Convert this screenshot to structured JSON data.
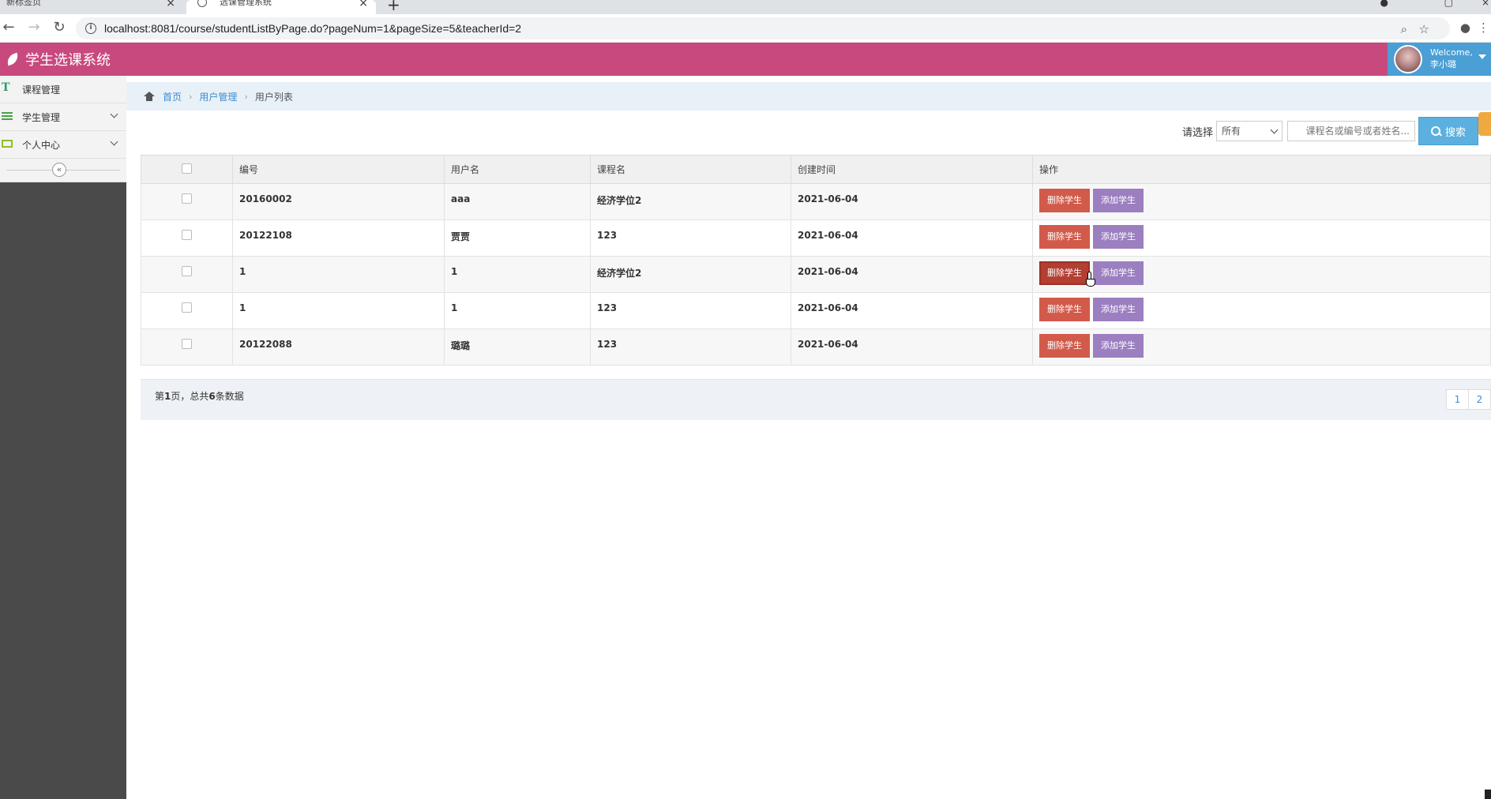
{
  "browser": {
    "tabs": [
      {
        "label": "新标签页"
      },
      {
        "label": "选课管理系统"
      }
    ],
    "url": "localhost:8081/course/studentListByPage.do?pageNum=1&pageSize=5&teacherId=2"
  },
  "header": {
    "brand": "学生选课系统",
    "welcome": "Welcome,",
    "user_name": "李小璐",
    "colors": {
      "header_bg": "#c8497e",
      "user_bg": "#4a9fd5"
    }
  },
  "sidebar": {
    "items": [
      {
        "label": "课程管理",
        "icon": "text-icon"
      },
      {
        "label": "学生管理",
        "icon": "list-icon"
      },
      {
        "label": "个人中心",
        "icon": "monitor-icon"
      }
    ],
    "collapse_glyph": "«"
  },
  "breadcrumb": {
    "home": "首页",
    "section": "用户管理",
    "current": "用户列表",
    "separator": "›"
  },
  "search": {
    "label": "请选择",
    "select_value": "所有",
    "placeholder": "课程名或编号或者姓名...",
    "button": "搜索"
  },
  "table": {
    "headers": [
      "编号",
      "用户名",
      "课程名",
      "创建时间",
      "操作"
    ],
    "rows": [
      {
        "id": "20160002",
        "username": "aaa",
        "course": "经济学位2",
        "created": "2021-06-04"
      },
      {
        "id": "20122108",
        "username": "贾贾",
        "course": "123",
        "created": "2021-06-04"
      },
      {
        "id": "1",
        "username": "1",
        "course": "经济学位2",
        "created": "2021-06-04"
      },
      {
        "id": "1",
        "username": "1",
        "course": "123",
        "created": "2021-06-04"
      },
      {
        "id": "20122088",
        "username": "璐璐",
        "course": "123",
        "created": "2021-06-04"
      }
    ],
    "delete_label": "删除学生",
    "add_label": "添加学生"
  },
  "pager": {
    "prefix": "第",
    "page": "1",
    "middle": "页，总共",
    "total": "6",
    "suffix": "条数据",
    "pages": [
      "1",
      "2"
    ]
  }
}
